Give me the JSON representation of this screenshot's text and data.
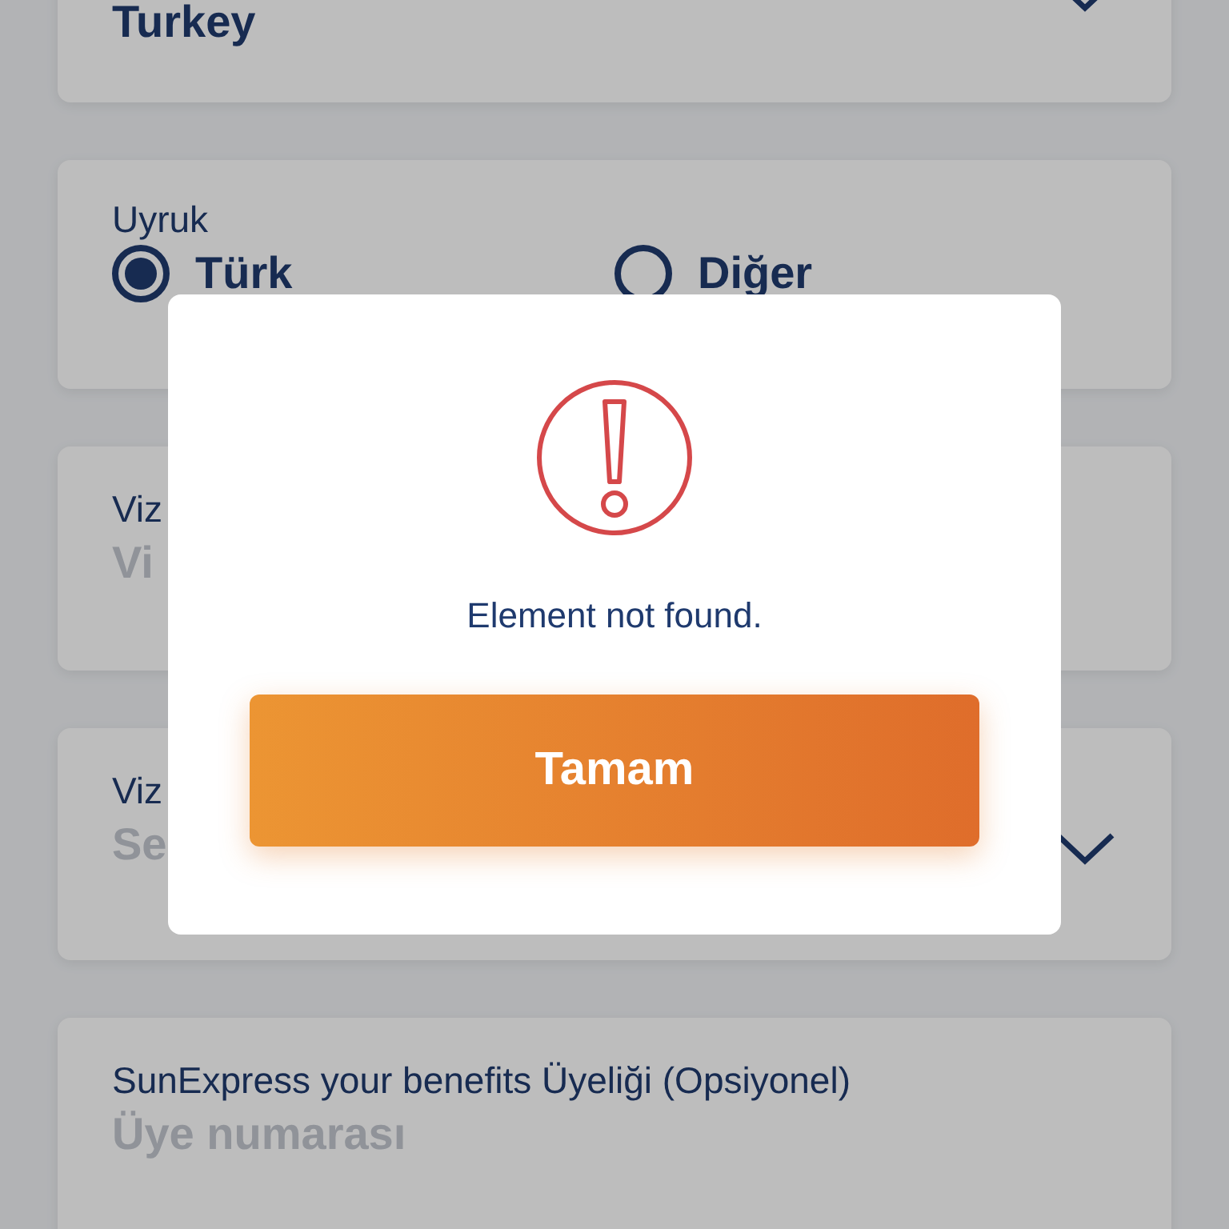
{
  "form": {
    "country": {
      "value": "Turkey"
    },
    "nationality": {
      "label": "Uyruk",
      "options": [
        {
          "label": "Türk",
          "selected": true
        },
        {
          "label": "Diğer",
          "selected": false
        }
      ]
    },
    "fields": [
      {
        "label": "Viz",
        "placeholder": "Vi",
        "kind": "text"
      },
      {
        "label": "Viz",
        "placeholder": "Se",
        "kind": "select"
      },
      {
        "label": "SunExpress your benefits Üyeliği (Opsiyonel)",
        "placeholder": "Üye numarası",
        "kind": "text"
      }
    ]
  },
  "dialog": {
    "message": "Element not found.",
    "button": "Tamam"
  }
}
